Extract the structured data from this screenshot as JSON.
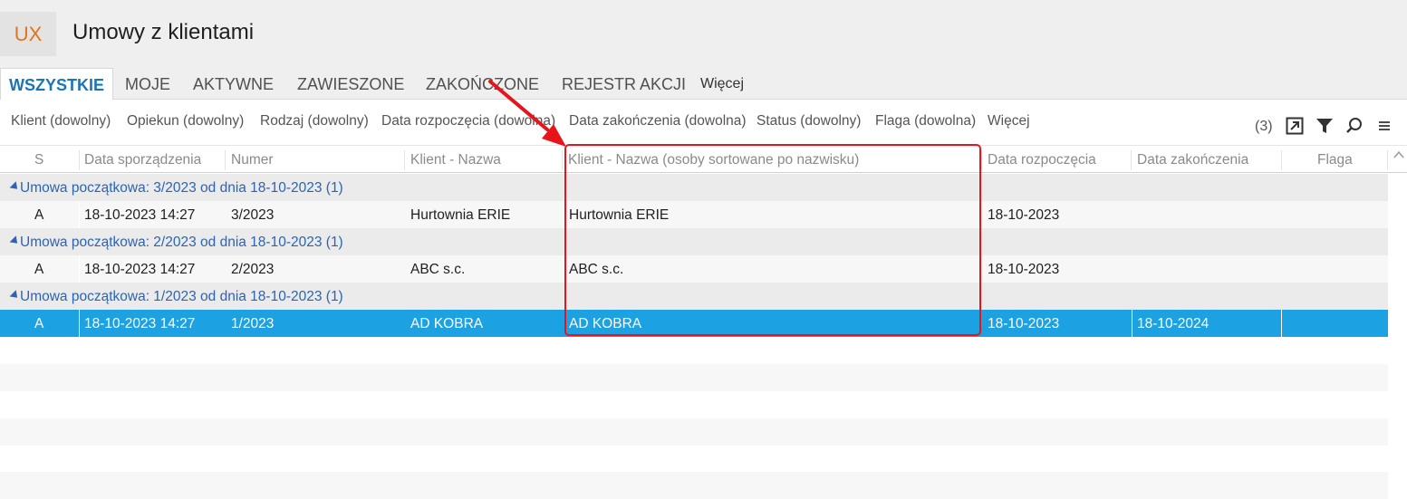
{
  "app": {
    "logo": "UX",
    "title": "Umowy z klientami"
  },
  "tabs": [
    {
      "label": "WSZYSTKIE",
      "active": true
    },
    {
      "label": "MOJE"
    },
    {
      "label": "AKTYWNE"
    },
    {
      "label": "ZAWIESZONE"
    },
    {
      "label": "ZAKOŃCZONE"
    },
    {
      "label": "REJESTR AKCJI"
    },
    {
      "label": "Więcej"
    }
  ],
  "filters": [
    "Klient (dowolny)",
    "Opiekun (dowolny)",
    "Rodzaj (dowolny)",
    "Data rozpoczęcia (dowolna)",
    "Data zakończenia (dowolna)",
    "Status (dowolny)",
    "Flaga (dowolna)",
    "Więcej"
  ],
  "toolbar": {
    "count": "(3)",
    "icons": [
      "expand-icon",
      "filter-icon",
      "search-icon",
      "menu-icon"
    ]
  },
  "columns": [
    "S",
    "Data sporządzenia",
    "Numer",
    "Klient - Nazwa",
    "Klient - Nazwa (osoby sortowane po nazwisku)",
    "Data rozpoczęcia",
    "Data zakończenia",
    "Flaga"
  ],
  "groups": [
    {
      "label": "Umowa początkowa: 3/2023 od dnia 18-10-2023 (1)",
      "row": [
        "A",
        "18-10-2023 14:27",
        "3/2023",
        "Hurtownia ERIE",
        "Hurtownia ERIE",
        "18-10-2023",
        "",
        ""
      ]
    },
    {
      "label": "Umowa początkowa: 2/2023 od dnia 18-10-2023 (1)",
      "row": [
        "A",
        "18-10-2023 14:27",
        "2/2023",
        "ABC s.c.",
        "ABC s.c.",
        "18-10-2023",
        "",
        ""
      ]
    },
    {
      "label": "Umowa początkowa: 1/2023 od dnia 18-10-2023 (1)",
      "row": [
        "A",
        "18-10-2023 14:27",
        "1/2023",
        "AD KOBRA",
        "AD KOBRA",
        "18-10-2023",
        "18-10-2024",
        ""
      ],
      "selected": true
    }
  ],
  "colors": {
    "accent": "#1a74b8",
    "selection": "#1ca1e2",
    "logo": "#e2741a",
    "group_text": "#2c64b5",
    "annotation": "#e8141c"
  }
}
